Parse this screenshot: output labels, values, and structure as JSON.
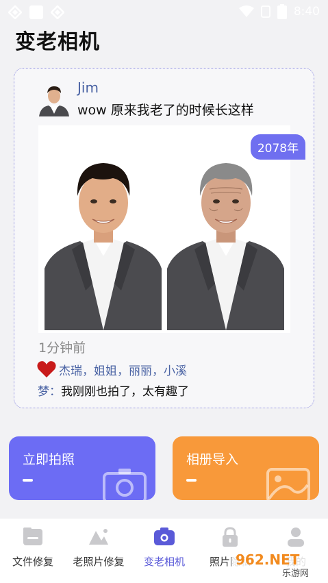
{
  "status_bar": {
    "time": "8:40"
  },
  "app": {
    "title": "变老相机"
  },
  "post": {
    "username": "Jim",
    "message": "wow 原来我老了的时候长这样",
    "year_badge": "2078年",
    "time_ago": "1分钟前",
    "likes": "杰瑞，姐姐，丽丽，小溪",
    "comment_author": "梦：",
    "comment_text": "我刚刚也拍了，太有趣了"
  },
  "actions": {
    "camera_label": "立即拍照",
    "album_label": "相册导入"
  },
  "nav": {
    "items": [
      {
        "label": "文件修复",
        "icon": "folder-icon"
      },
      {
        "label": "老照片修复",
        "icon": "photo-icon"
      },
      {
        "label": "变老相机",
        "icon": "camera-icon"
      },
      {
        "label": "照片隐私",
        "icon": "lock-icon"
      },
      {
        "label": "我的",
        "icon": "user-icon"
      }
    ],
    "active_index": 2
  },
  "watermark": {
    "text": "962.NET",
    "subtext": "乐游网"
  },
  "colors": {
    "primary": "#6c6cf4",
    "orange": "#f8993a",
    "link": "#4a63a4",
    "heart": "#c81a1a"
  }
}
